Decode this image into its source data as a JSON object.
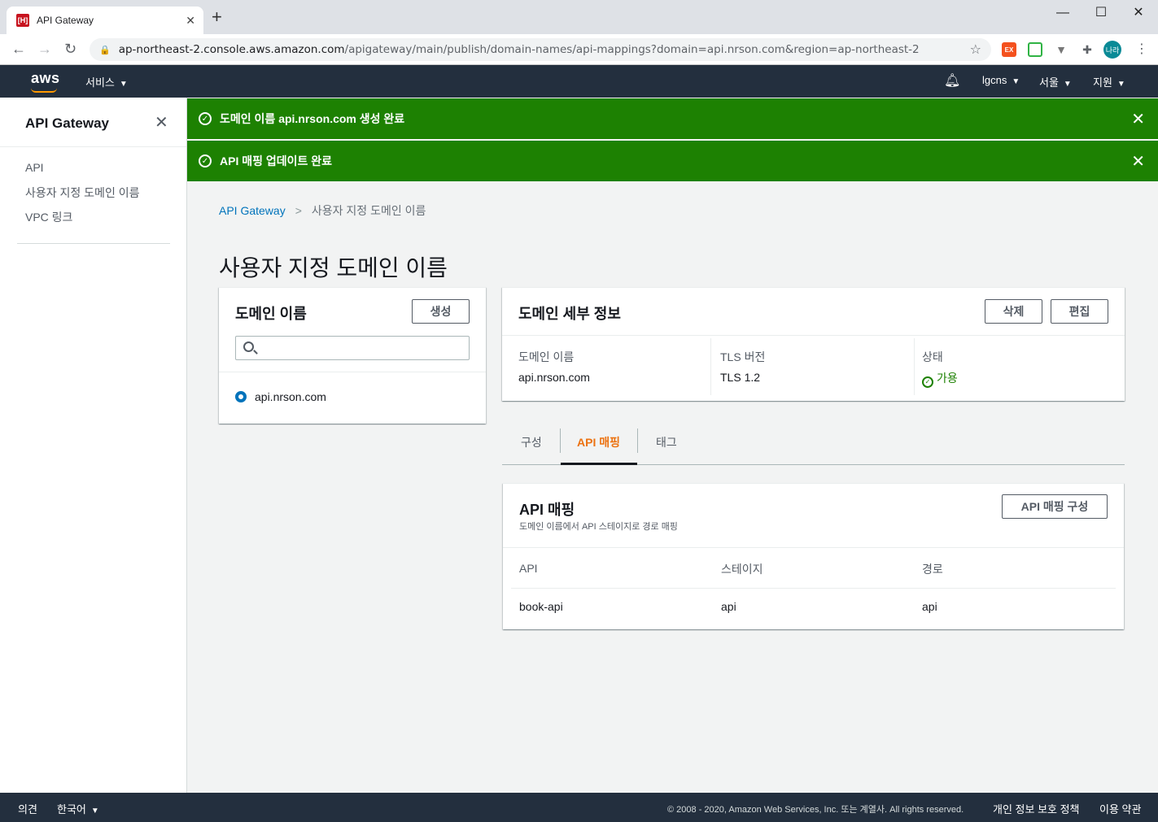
{
  "browser": {
    "tab_title": "API Gateway",
    "favicon_label": "[H]",
    "url_host": "ap-northeast-2.console.aws.amazon.com",
    "url_path": "/apigateway/main/publish/domain-names/api-mappings?domain=api.nrson.com&region=ap-northeast-2",
    "profile_label": "나라"
  },
  "aws_header": {
    "logo": "aws",
    "services_label": "서비스",
    "account_label": "lgcns",
    "region_label": "서울",
    "support_label": "지원"
  },
  "sidebar": {
    "title": "API Gateway",
    "items": [
      {
        "label": "API"
      },
      {
        "label": "사용자 지정 도메인 이름"
      },
      {
        "label": "VPC 링크"
      }
    ]
  },
  "flash": [
    {
      "prefix": "도메인 이름 ",
      "domain": "api.nrson.com",
      "suffix": " 생성 완료"
    },
    {
      "text": "API 매핑 업데이트 완료"
    }
  ],
  "breadcrumb": {
    "root": "API Gateway",
    "current": "사용자 지정 도메인 이름"
  },
  "page_title": "사용자 지정 도메인 이름",
  "domain_panel": {
    "title": "도메인 이름",
    "create_label": "생성",
    "search_placeholder": "",
    "selected_domain": "api.nrson.com"
  },
  "details_panel": {
    "title": "도메인 세부 정보",
    "delete_label": "삭제",
    "edit_label": "편집",
    "fields": [
      {
        "label": "도메인 이름",
        "value": "api.nrson.com"
      },
      {
        "label": "TLS 버전",
        "value": "TLS 1.2"
      },
      {
        "label": "상태",
        "value": "가용"
      }
    ]
  },
  "content_tabs": [
    {
      "label": "구성"
    },
    {
      "label": "API 매핑"
    },
    {
      "label": "태그"
    }
  ],
  "mapping_panel": {
    "title": "API 매핑",
    "subtitle": "도메인 이름에서 API 스테이지로 경로 매핑",
    "configure_label": "API 매핑 구성",
    "columns": [
      "API",
      "스테이지",
      "경로"
    ],
    "rows": [
      [
        "book-api",
        "api",
        "api"
      ]
    ]
  },
  "footer": {
    "feedback": "의견",
    "language": "한국어",
    "copyright": "© 2008 - 2020, Amazon Web Services, Inc. 또는 계열사. All rights reserved.",
    "privacy": "개인 정보 보호 정책",
    "terms": "이용 약관"
  },
  "colors": {
    "success": "#1d8102",
    "link": "#0073bb",
    "active_tab": "#ec7211",
    "header_bg": "#232f3e"
  }
}
